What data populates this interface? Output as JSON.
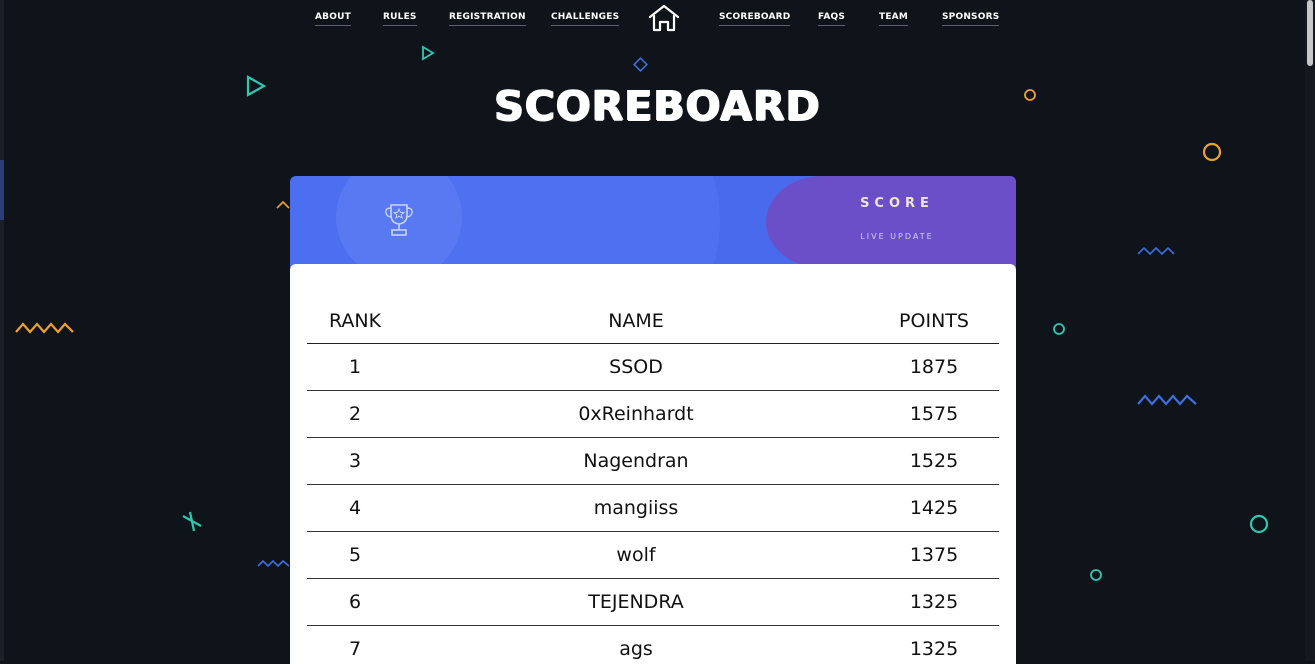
{
  "nav": {
    "links": [
      "ABOUT",
      "RULES",
      "REGISTRATION",
      "CHALLENGES",
      "SCOREBOARD",
      "FAQS",
      "TEAM",
      "SPONSORS"
    ],
    "home_icon": "home-icon"
  },
  "page": {
    "title": "SCOREBOARD"
  },
  "score_header": {
    "title": "SCORE",
    "subtitle": "LIVE UPDATE",
    "icon": "trophy-icon"
  },
  "table": {
    "headers": [
      "RANK",
      "NAME",
      "POINTS"
    ],
    "rows": [
      {
        "rank": "1",
        "name": "SSOD",
        "points": "1875"
      },
      {
        "rank": "2",
        "name": "0xReinhardt",
        "points": "1575"
      },
      {
        "rank": "3",
        "name": "Nagendran",
        "points": "1525"
      },
      {
        "rank": "4",
        "name": "mangiiss",
        "points": "1425"
      },
      {
        "rank": "5",
        "name": "wolf",
        "points": "1375"
      },
      {
        "rank": "6",
        "name": "TEJENDRA",
        "points": "1325"
      },
      {
        "rank": "7",
        "name": "ags",
        "points": "1325"
      }
    ]
  },
  "colors": {
    "background": "#0f141b",
    "header_blue": "#4c6ef0",
    "header_purple": "#6a4fc9",
    "accent_teal": "#2fc7b0",
    "accent_orange": "#f0a030",
    "accent_blue": "#3d6fe0"
  }
}
